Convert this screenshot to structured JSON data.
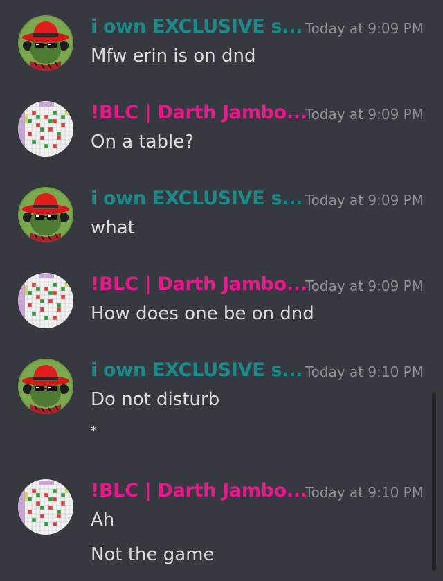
{
  "colors": {
    "background": "#36393f",
    "user_teal": "#1a8b8b",
    "user_pink": "#e9178c",
    "timestamp": "#8e9297",
    "text": "#dcddde"
  },
  "messages": [
    {
      "author": "i own EXCLUSIVE s...",
      "avatar": "red-hat-sunglasses-avatar",
      "timestamp": "Today at 9:09 PM",
      "lines": [
        "Mfw erin is on dnd"
      ]
    },
    {
      "author": "!BLC | Darth Jambo...",
      "avatar": "pixel-mosaic-avatar",
      "timestamp": "Today at 9:09 PM",
      "lines": [
        "On a table?"
      ]
    },
    {
      "author": "i own EXCLUSIVE s...",
      "avatar": "red-hat-sunglasses-avatar",
      "timestamp": "Today at 9:09 PM",
      "lines": [
        "what"
      ]
    },
    {
      "author": "!BLC | Darth Jambo...",
      "avatar": "pixel-mosaic-avatar",
      "timestamp": "Today at 9:09 PM",
      "lines": [
        "How does one be on dnd"
      ]
    },
    {
      "author": "i own EXCLUSIVE s...",
      "avatar": "red-hat-sunglasses-avatar",
      "timestamp": "Today at 9:10 PM",
      "lines": [
        "Do not disturb",
        "*"
      ]
    },
    {
      "author": "!BLC | Darth Jambo...",
      "avatar": "pixel-mosaic-avatar",
      "timestamp": "Today at 9:10 PM",
      "lines": [
        "Ah",
        "Not the game"
      ]
    }
  ]
}
